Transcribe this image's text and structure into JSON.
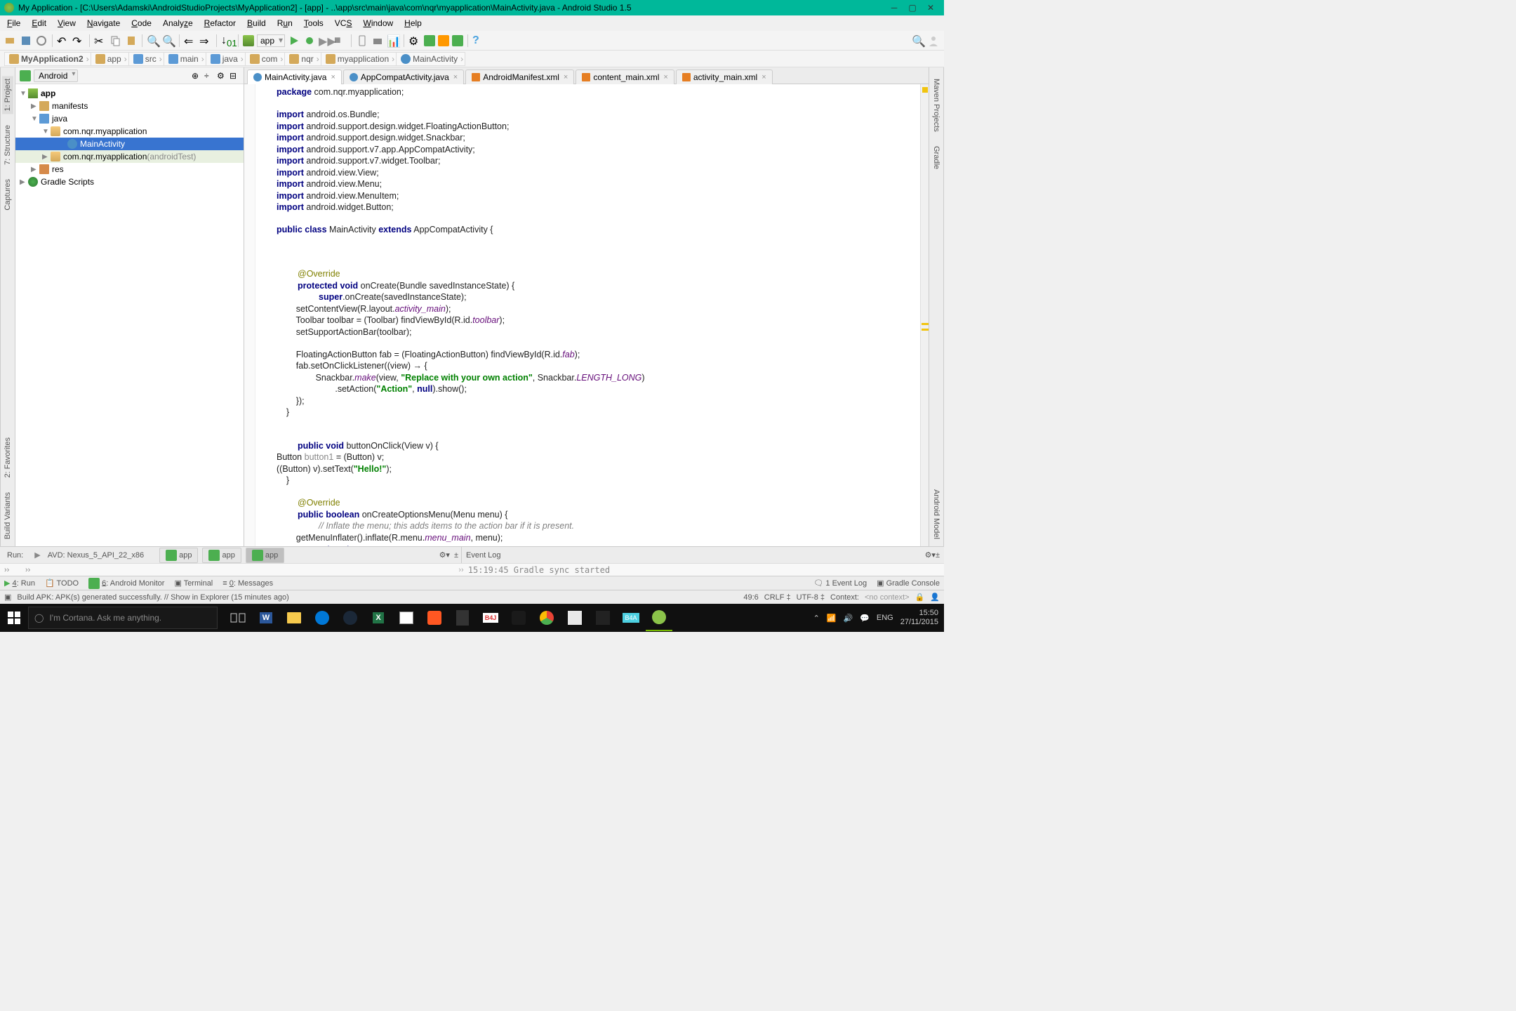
{
  "title": "My Application - [C:\\Users\\Adamski\\AndroidStudioProjects\\MyApplication2] - [app] - ..\\app\\src\\main\\java\\com\\nqr\\myapplication\\MainActivity.java - Android Studio 1.5",
  "menu": [
    "File",
    "Edit",
    "View",
    "Navigate",
    "Code",
    "Analyze",
    "Refactor",
    "Build",
    "Run",
    "Tools",
    "VCS",
    "Window",
    "Help"
  ],
  "run_config": "app",
  "breadcrumbs": [
    "MyApplication2",
    "app",
    "src",
    "main",
    "java",
    "com",
    "nqr",
    "myapplication",
    "MainActivity"
  ],
  "project_dropdown": "Android",
  "tree": {
    "root": "app",
    "manifests": "manifests",
    "java": "java",
    "pkg1": "com.nqr.myapplication",
    "main_class": "MainActivity",
    "pkg2": "com.nqr.myapplication",
    "pkg2_suffix": "(androidTest)",
    "res": "res",
    "gradle": "Gradle Scripts"
  },
  "tabs": [
    {
      "label": "MainActivity.java",
      "kind": "java",
      "active": true
    },
    {
      "label": "AppCompatActivity.java",
      "kind": "java",
      "active": false
    },
    {
      "label": "AndroidManifest.xml",
      "kind": "xml",
      "active": false
    },
    {
      "label": "content_main.xml",
      "kind": "xml",
      "active": false
    },
    {
      "label": "activity_main.xml",
      "kind": "xml",
      "active": false
    }
  ],
  "left_tool": [
    "1: Project",
    "7: Structure",
    "Captures"
  ],
  "left_tool2": [
    "2: Favorites",
    "Build Variants"
  ],
  "right_tool": [
    "Maven Projects",
    "Gradle"
  ],
  "right_tool2": [
    "Android Model"
  ],
  "run_bar": {
    "label": "Run:",
    "device": "AVD: Nexus_5_API_22_x86",
    "tabs": [
      "app",
      "app",
      "app"
    ]
  },
  "event_log_label": "Event Log",
  "event_line": "15:19:45 Gradle sync started",
  "bottom_tabs": [
    "4: Run",
    "TODO",
    "6: Android Monitor",
    "Terminal",
    "0: Messages"
  ],
  "bottom_right": [
    "1 Event Log",
    "Gradle Console"
  ],
  "status": {
    "message": "Build APK: APK(s) generated successfully. // Show in Explorer (15 minutes ago)",
    "pos": "49:6",
    "line_end": "CRLF ‡",
    "enc": "UTF-8 ‡",
    "ctx_label": "Context:",
    "ctx": "<no context>"
  },
  "taskbar": {
    "search": "I'm Cortana. Ask me anything.",
    "lang": "ENG",
    "time": "15:50",
    "date": "27/11/2015"
  },
  "code": {
    "l1": {
      "a": "package",
      "b": " com.nqr.myapplication;"
    },
    "l3a": "import",
    "l3b": " android.os.Bundle;",
    "l4a": "import",
    "l4b": " android.support.design.widget.FloatingActionButton;",
    "l5a": "import",
    "l5b": " android.support.design.widget.Snackbar;",
    "l6a": "import",
    "l6b": " android.support.v7.app.AppCompatActivity;",
    "l7a": "import",
    "l7b": " android.support.v7.widget.Toolbar;",
    "l8a": "import",
    "l8b": " android.view.View;",
    "l9a": "import",
    "l9b": " android.view.Menu;",
    "l10a": "import",
    "l10b": " android.view.MenuItem;",
    "l11a": "import",
    "l11b": " android.widget.Button;",
    "l13a": "public class",
    "l13b": " MainActivity ",
    "l13c": "extends",
    "l13d": " AppCompatActivity {",
    "l17": "@Override",
    "l18a": "protected void",
    "l18b": " onCreate(Bundle savedInstanceState) {",
    "l19a": "super",
    "l19b": ".onCreate(savedInstanceState);",
    "l20a": "        setContentView(R.layout.",
    "l20b": "activity_main",
    "l20c": ");",
    "l21a": "        Toolbar toolbar = (Toolbar) findViewById(R.id.",
    "l21b": "toolbar",
    "l21c": ");",
    "l22": "        setSupportActionBar(toolbar);",
    "l24a": "        FloatingActionButton fab = (FloatingActionButton) findViewById(R.id.",
    "l24b": "fab",
    "l24c": ");",
    "l25": "        fab.setOnClickListener((view) → {",
    "l26a": "                Snackbar.",
    "l26b": "make",
    "l26c": "(view, ",
    "l26d": "\"Replace with your own action\"",
    "l26e": ", Snackbar.",
    "l26f": "LENGTH_LONG",
    "l26g": ")",
    "l27a": "                        .setAction(",
    "l27b": "\"Action\"",
    "l27c": ", ",
    "l27d": "null",
    "l27e": ").show();",
    "l28": "        });",
    "l29": "    }",
    "l32a": "public void",
    "l32b": " buttonOnClick(View v) {",
    "l33a": "Button ",
    "l33b": "button1",
    "l33c": " = (Button) v;",
    "l34a": "((Button) v).setText(",
    "l34b": "\"Hello!\"",
    "l34c": ");",
    "l35": "    }",
    "l37": "@Override",
    "l38a": "public boolean",
    "l38b": " onCreateOptionsMenu(Menu menu) {",
    "l39": "// Inflate the menu; this adds items to the action bar if it is present.",
    "l40a": "        getMenuInflater().inflate(R.menu.",
    "l40b": "menu_main",
    "l40c": ", menu);",
    "l41a": "return true",
    "l41b": ";",
    "l42": "    }"
  }
}
